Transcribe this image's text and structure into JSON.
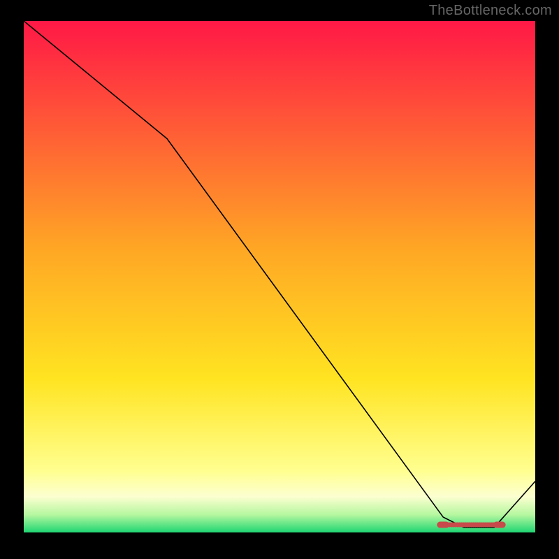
{
  "watermark": "TheBottleneck.com",
  "chart_data": {
    "type": "line",
    "title": "",
    "xlabel": "",
    "ylabel": "",
    "xlim_normalized": [
      0,
      100
    ],
    "ylim_normalized": [
      0,
      100
    ],
    "series": [
      {
        "name": "bottleneck-curve",
        "color": "#000000",
        "x": [
          0,
          28,
          82,
          86,
          92,
          100
        ],
        "y": [
          100,
          77,
          3,
          1,
          1,
          10
        ]
      }
    ],
    "optimal_segment": {
      "color": "#c84a4a",
      "x_start": 82,
      "x_end": 93,
      "y": 1.5
    },
    "background_gradient_stops": [
      {
        "offset": 0.0,
        "color": "#ff1846"
      },
      {
        "offset": 0.45,
        "color": "#ffa824"
      },
      {
        "offset": 0.7,
        "color": "#ffe421"
      },
      {
        "offset": 0.88,
        "color": "#ffff90"
      },
      {
        "offset": 0.93,
        "color": "#fcffd0"
      },
      {
        "offset": 0.965,
        "color": "#b6f7a0"
      },
      {
        "offset": 1.0,
        "color": "#1fd672"
      }
    ]
  }
}
